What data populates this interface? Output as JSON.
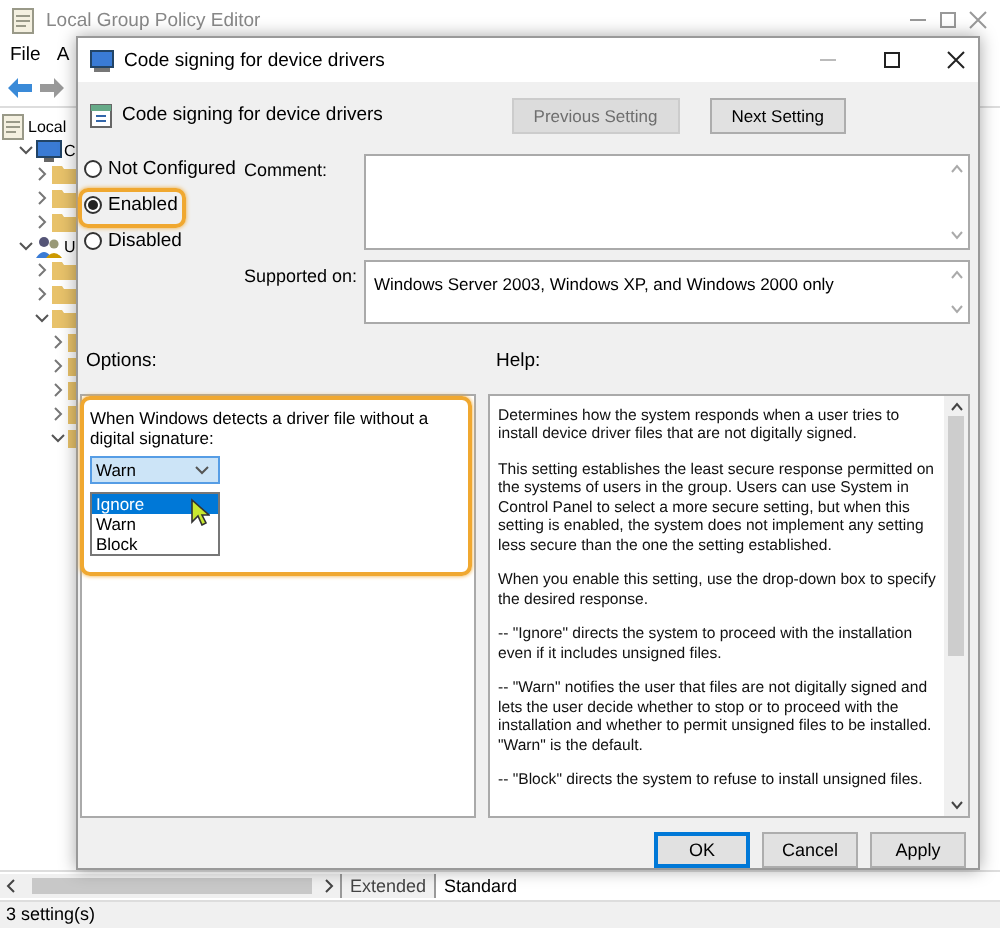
{
  "app_window": {
    "title": "Local Group Policy Editor",
    "menu": [
      "File",
      "A"
    ],
    "tree": [
      {
        "label": "Local",
        "children": [
          {
            "label": "C",
            "expanded": true,
            "children": [
              {
                "expanded": false
              },
              {
                "expanded": false
              },
              {
                "expanded": false
              }
            ]
          },
          {
            "label": "U",
            "expanded": true,
            "children": [
              {
                "expanded": false
              },
              {
                "expanded": false
              },
              {
                "expanded": true,
                "children": [
                  {
                    "expanded": false
                  },
                  {
                    "expanded": false
                  },
                  {
                    "expanded": false
                  },
                  {
                    "expanded": false
                  },
                  {
                    "expanded": true
                  }
                ]
              }
            ]
          }
        ]
      }
    ],
    "tabs": [
      {
        "label": "Extended",
        "selected": false
      },
      {
        "label": "Standard",
        "selected": true
      }
    ],
    "status_bar": "3 setting(s)"
  },
  "dialog": {
    "title": "Code signing for device drivers",
    "heading": "Code signing for device drivers",
    "nav_buttons": [
      {
        "label": "Previous Setting",
        "disabled": true
      },
      {
        "label": "Next Setting",
        "disabled": false
      }
    ],
    "state_options": [
      {
        "label": "Not Configured",
        "selected": false
      },
      {
        "label": "Enabled",
        "selected": true
      },
      {
        "label": "Disabled",
        "selected": false
      }
    ],
    "comment_label": "Comment:",
    "supported_label": "Supported on:",
    "supported_on": "Windows Server 2003, Windows XP, and Windows 2000 only",
    "options_label": "Options:",
    "help_label": "Help:",
    "option_prompt": "When Windows detects a driver file without a digital signature:",
    "dropdown": {
      "value": "Warn",
      "expanded": true,
      "options": [
        {
          "label": "Ignore",
          "highlighted": true
        },
        {
          "label": "Warn",
          "highlighted": false
        },
        {
          "label": "Block",
          "highlighted": false
        }
      ]
    },
    "help": [
      "Determines how the system responds when a user tries to install device driver files that are not digitally signed.",
      "This setting establishes the least secure response permitted on the systems of users in the group. Users can use System in Control Panel to select a more secure setting, but when this setting is enabled, the system does not implement any setting less secure than the one the setting established.",
      "When you enable this setting, use the drop-down box to specify the desired response.",
      "--   \"Ignore\" directs the system to proceed with the installation even if it includes unsigned files.",
      "--   \"Warn\" notifies the user that files are not digitally signed and lets the user decide whether to stop or to proceed with the installation and whether to permit unsigned files to be installed. \"Warn\" is the default.",
      "--   \"Block\" directs the system to refuse to install unsigned files."
    ],
    "buttons": [
      {
        "label": "OK",
        "default": true
      },
      {
        "label": "Cancel",
        "default": false
      },
      {
        "label": "Apply",
        "default": false
      }
    ]
  }
}
